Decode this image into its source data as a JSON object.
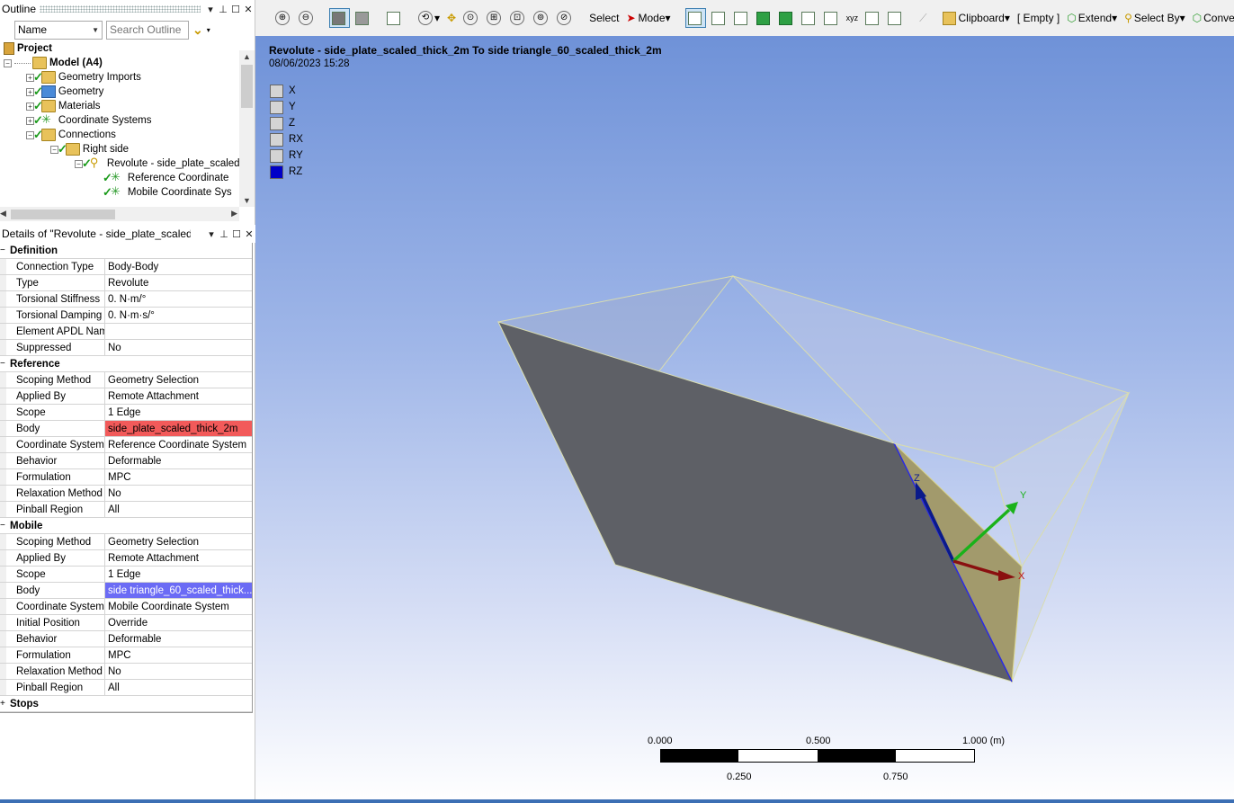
{
  "outline": {
    "title": "Outline",
    "name_combo": "Name",
    "search_placeholder": "Search Outline",
    "tree": [
      {
        "label": "Project"
      },
      {
        "label": "Model (A4)"
      },
      {
        "label": "Geometry Imports"
      },
      {
        "label": "Geometry"
      },
      {
        "label": "Materials"
      },
      {
        "label": "Coordinate Systems"
      },
      {
        "label": "Connections"
      },
      {
        "label": "Right side"
      },
      {
        "label": "Revolute - side_plate_scaled"
      },
      {
        "label": "Reference Coordinate"
      },
      {
        "label": "Mobile Coordinate Sys"
      }
    ]
  },
  "details": {
    "title": "Details of \"Revolute - side_plate_scaled_t",
    "sections": [
      {
        "name": "Definition",
        "rows": [
          {
            "k": "Connection Type",
            "v": "Body-Body"
          },
          {
            "k": "Type",
            "v": "Revolute"
          },
          {
            "k": "Torsional Stiffness",
            "v": "0. N·m/°"
          },
          {
            "k": "Torsional Damping",
            "v": "0. N·m·s/°"
          },
          {
            "k": "Element APDL Name",
            "v": ""
          },
          {
            "k": "Suppressed",
            "v": "No"
          }
        ]
      },
      {
        "name": "Reference",
        "rows": [
          {
            "k": "Scoping Method",
            "v": "Geometry Selection"
          },
          {
            "k": "Applied By",
            "v": "Remote Attachment"
          },
          {
            "k": "Scope",
            "v": "1 Edge"
          },
          {
            "k": "Body",
            "v": "side_plate_scaled_thick_2m",
            "style": "red"
          },
          {
            "k": "Coordinate System",
            "v": "Reference Coordinate System"
          },
          {
            "k": "Behavior",
            "v": "Deformable"
          },
          {
            "k": "Formulation",
            "v": "MPC"
          },
          {
            "k": "Relaxation Method",
            "v": "No"
          },
          {
            "k": "Pinball Region",
            "v": "All"
          }
        ]
      },
      {
        "name": "Mobile",
        "rows": [
          {
            "k": "Scoping Method",
            "v": "Geometry Selection"
          },
          {
            "k": "Applied By",
            "v": "Remote Attachment"
          },
          {
            "k": "Scope",
            "v": "1 Edge"
          },
          {
            "k": "Body",
            "v": "side triangle_60_scaled_thick...",
            "style": "blue"
          },
          {
            "k": "Coordinate System",
            "v": "Mobile Coordinate System"
          },
          {
            "k": "Initial Position",
            "v": "Override"
          },
          {
            "k": "Behavior",
            "v": "Deformable"
          },
          {
            "k": "Formulation",
            "v": "MPC"
          },
          {
            "k": "Relaxation Method",
            "v": "No"
          },
          {
            "k": "Pinball Region",
            "v": "All"
          }
        ]
      },
      {
        "name": "Stops",
        "rows": []
      }
    ]
  },
  "toolbar": {
    "select": "Select",
    "mode": "Mode",
    "clipboard": "Clipboard",
    "empty": "[ Empty ]",
    "extend": "Extend",
    "select_by": "Select By",
    "convert": "Conve"
  },
  "viewport": {
    "title": "Revolute - side_plate_scaled_thick_2m To side triangle_60_scaled_thick_2m",
    "date": "08/06/2023 15:28",
    "dofs": [
      {
        "label": "X",
        "on": false
      },
      {
        "label": "Y",
        "on": false
      },
      {
        "label": "Z",
        "on": false
      },
      {
        "label": "RX",
        "on": false
      },
      {
        "label": "RY",
        "on": false
      },
      {
        "label": "RZ",
        "on": true
      }
    ],
    "triad": {
      "x": "X",
      "y": "Y",
      "z": "Z"
    },
    "scale": {
      "t0": "0.000",
      "t1": "0.500",
      "t2": "1.000 (m)",
      "b1": "0.250",
      "b2": "0.750"
    }
  },
  "colors": {
    "reference_body": "#f25a5a",
    "mobile_body": "#6b6bf5",
    "rz_active": "#0000c8"
  }
}
